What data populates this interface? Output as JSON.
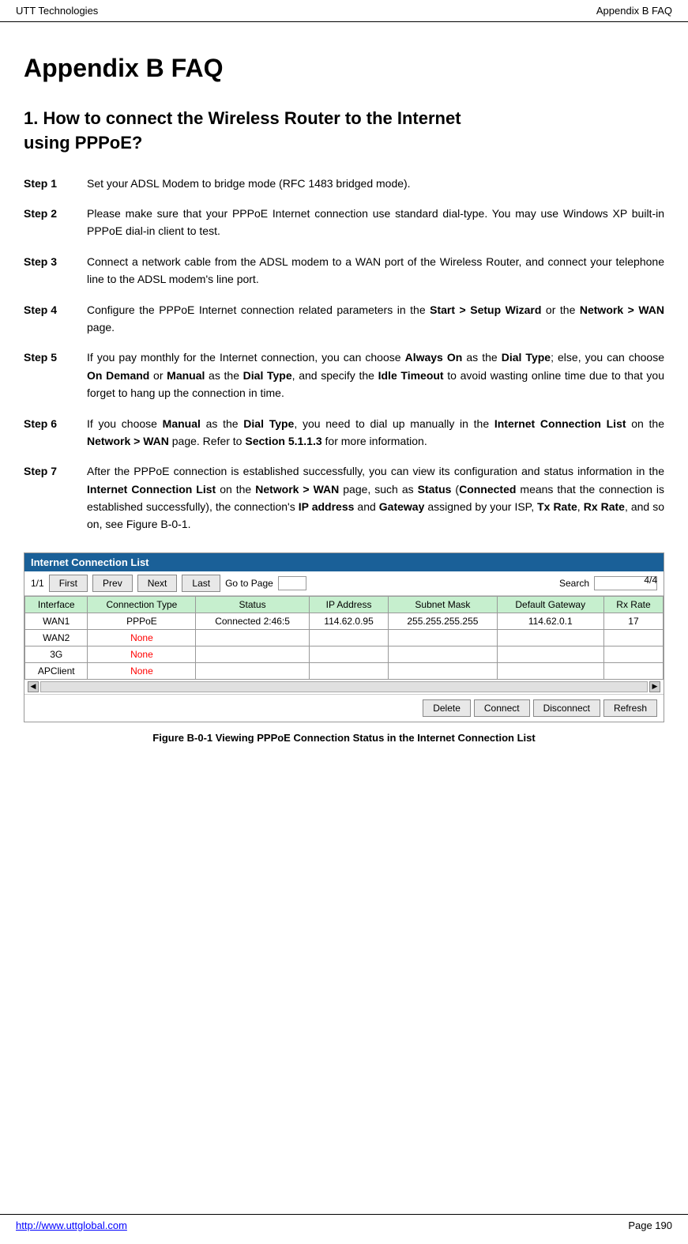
{
  "header": {
    "left": "UTT Technologies",
    "right": "Appendix B FAQ"
  },
  "page_title": "Appendix B FAQ",
  "section1": {
    "heading_line1": "1.    How to connect the Wireless Router to the Internet",
    "heading_line2": "using PPPoE?"
  },
  "steps": [
    {
      "label": "Step 1",
      "content": "Set your ADSL Modem to bridge mode (RFC 1483 bridged mode)."
    },
    {
      "label": "Step 2",
      "content": "Please make sure that your PPPoE Internet connection use standard dial-type. You may use Windows XP built-in PPPoE dial-in client to test."
    },
    {
      "label": "Step 3",
      "content": "Connect a network cable from the ADSL modem to a WAN port of the Wireless Router, and connect your telephone line to the ADSL modem's line port."
    },
    {
      "label": "Step 4",
      "content_parts": [
        {
          "text": "Configure the PPPoE Internet connection related parameters in the "
        },
        {
          "text": "Start > Setup Wizard",
          "bold": true
        },
        {
          "text": " or the "
        },
        {
          "text": "Network > WAN",
          "bold": true
        },
        {
          "text": " page."
        }
      ]
    },
    {
      "label": "Step 5",
      "content_parts": [
        {
          "text": "If you pay monthly for the Internet connection, you can choose "
        },
        {
          "text": "Always On",
          "bold": true
        },
        {
          "text": " as the "
        },
        {
          "text": "Dial Type",
          "bold": true
        },
        {
          "text": "; else, you can choose "
        },
        {
          "text": "On Demand",
          "bold": true
        },
        {
          "text": " or "
        },
        {
          "text": "Manual",
          "bold": true
        },
        {
          "text": " as the "
        },
        {
          "text": "Dial Type",
          "bold": true
        },
        {
          "text": ", and specify the "
        },
        {
          "text": "Idle Timeout",
          "bold": true
        },
        {
          "text": " to avoid wasting online time due to that you forget to hang up the connection in time."
        }
      ]
    },
    {
      "label": "Step 6",
      "content_parts": [
        {
          "text": "If you choose "
        },
        {
          "text": "Manual",
          "bold": true
        },
        {
          "text": " as the "
        },
        {
          "text": "Dial Type",
          "bold": true
        },
        {
          "text": ", you need to dial up manually in the "
        },
        {
          "text": "Internet Connection List",
          "bold": true
        },
        {
          "text": " on the "
        },
        {
          "text": "Network > WAN",
          "bold": true
        },
        {
          "text": " page. Refer to "
        },
        {
          "text": "Section 5.1.1.3",
          "bold": true
        },
        {
          "text": " for more information."
        }
      ]
    },
    {
      "label": "Step 7",
      "content_parts": [
        {
          "text": "After the PPPoE connection is established successfully, you can view its configuration and status information in the "
        },
        {
          "text": "Internet Connection List",
          "bold": true
        },
        {
          "text": " on the "
        },
        {
          "text": "Network > WAN",
          "bold": true
        },
        {
          "text": " page, such as "
        },
        {
          "text": "Status",
          "bold": true
        },
        {
          "text": " ("
        },
        {
          "text": "Connected",
          "bold": true
        },
        {
          "text": " means that the connection is established successfully), the connection's "
        },
        {
          "text": "IP address",
          "bold": true
        },
        {
          "text": " and "
        },
        {
          "text": "Gateway",
          "bold": true
        },
        {
          "text": " assigned by your ISP, "
        },
        {
          "text": "Tx Rate",
          "bold": true
        },
        {
          "text": ", "
        },
        {
          "text": "Rx Rate",
          "bold": true
        },
        {
          "text": ", and so on, see Figure B-0-1."
        }
      ]
    }
  ],
  "figure": {
    "title": "Internet Connection List",
    "page_count": "4/4",
    "pagination": {
      "current": "1/1",
      "first": "First",
      "prev": "Prev",
      "next": "Next",
      "last": "Last",
      "goto_label": "Go to  Page",
      "search_label": "Search"
    },
    "table": {
      "headers": [
        "Interface",
        "Connection Type",
        "Status",
        "IP Address",
        "Subnet Mask",
        "Default Gateway",
        "Rx Rate"
      ],
      "rows": [
        {
          "interface": "WAN1",
          "conn_type": "PPPoE",
          "status": "Connected 2:46:5",
          "ip": "114.62.0.95",
          "subnet": "255.255.255.255",
          "gateway": "114.62.0.1",
          "rxrate": "17",
          "none": false
        },
        {
          "interface": "WAN2",
          "conn_type": "None",
          "status": "",
          "ip": "",
          "subnet": "",
          "gateway": "",
          "rxrate": "",
          "none": true
        },
        {
          "interface": "3G",
          "conn_type": "None",
          "status": "",
          "ip": "",
          "subnet": "",
          "gateway": "",
          "rxrate": "",
          "none": true
        },
        {
          "interface": "APClient",
          "conn_type": "None",
          "status": "",
          "ip": "",
          "subnet": "",
          "gateway": "",
          "rxrate": "",
          "none": true
        }
      ]
    },
    "buttons": {
      "delete": "Delete",
      "connect": "Connect",
      "disconnect": "Disconnect",
      "refresh": "Refresh"
    },
    "caption": "Figure B-0-1 Viewing PPPoE Connection Status in the Internet Connection List"
  },
  "footer": {
    "link_text": "http://www.uttglobal.com",
    "page_number": "Page 190"
  }
}
